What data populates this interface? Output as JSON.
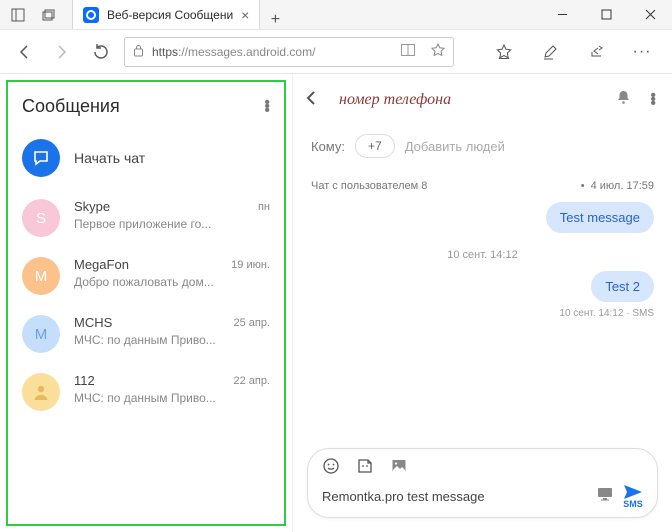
{
  "window": {
    "tab_title": "Веб-версия Сообщени",
    "url_prefix": "https",
    "url_rest": "://messages.android.com/"
  },
  "sidebar": {
    "title": "Сообщения",
    "new_chat_label": "Начать чат",
    "conversations": [
      {
        "avatar": "S",
        "name": "Skype",
        "preview": "Первое приложение го...",
        "time": "пн"
      },
      {
        "avatar": "M",
        "name": "MegaFon",
        "preview": "Добро пожаловать дом...",
        "time": "19 июн."
      },
      {
        "avatar": "M",
        "name": "MCHS",
        "preview": "МЧС: по данным Приво...",
        "time": "25 апр."
      },
      {
        "avatar": "",
        "name": "112",
        "preview": "МЧС: по данным Приво...",
        "time": "22 апр."
      }
    ]
  },
  "chat": {
    "header_title": "номер телефона",
    "to_label": "Кому:",
    "recipient_chip": "+7",
    "add_people": "Добавить людей",
    "day_label": "Чат с пользователем 8",
    "day_time": "4 июл. 17:59",
    "msg1": "Test message",
    "ts_center": "10 сент. 14:12",
    "msg2": "Test 2",
    "meta2": "10 сент. 14:12 · SMS",
    "compose_text": "Remontka.pro test message",
    "send_label": "SMS"
  }
}
